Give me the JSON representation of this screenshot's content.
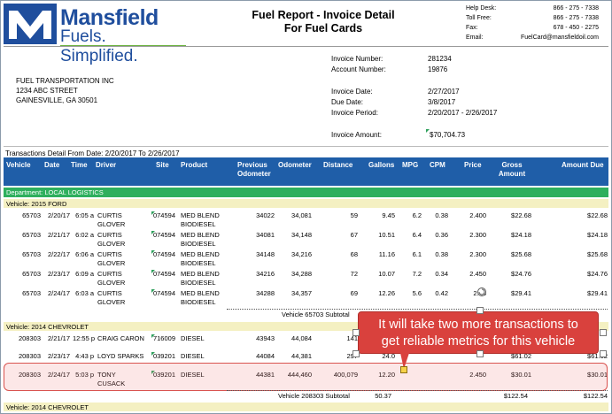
{
  "header": {
    "logo_name": "Mansfield",
    "logo_tagline": "Fuels. Simplified.",
    "title_line1": "Fuel Report - Invoice Detail",
    "title_line2": "For Fuel Cards"
  },
  "contact": {
    "help_label": "Help Desk:",
    "help_value": "866 - 275 - 7338",
    "tollfree_label": "Toll Free:",
    "tollfree_value": "866 - 275 - 7338",
    "fax_label": "Fax:",
    "fax_value": "678 - 450 - 2275",
    "email_label": "Email:",
    "email_value": "FuelCard@mansfieldoil.com"
  },
  "customer": {
    "name": "FUEL TRANSPORTATION INC",
    "street": "1234 ABC STREET",
    "city": "GAINESVILLE, GA 30501"
  },
  "invoice": {
    "number_label": "Invoice Number:",
    "number": "281234",
    "account_label": "Account Number:",
    "account": "19876",
    "date_label": "Invoice Date:",
    "date": "2/27/2017",
    "due_label": "Due Date:",
    "due": "3/8/2017",
    "period_label": "Invoice Period:",
    "period": "2/20/2017 - 2/26/2017",
    "amount_label": "Invoice Amount:",
    "amount": "$70,704.73"
  },
  "table": {
    "caption": "Transactions Detail From Date: 2/20/2017 To 2/26/2017",
    "headers": {
      "vehicle": "Vehicle",
      "date": "Date",
      "time": "Time",
      "driver": "Driver",
      "site": "Site",
      "product": "Product",
      "prev_odo_1": "Previous",
      "prev_odo_2": "Odometer",
      "odometer": "Odometer",
      "distance": "Distance",
      "gallons": "Gallons",
      "mpg": "MPG",
      "cpm": "CPM",
      "price": "Price",
      "gross_1": "Gross",
      "gross_2": "Amount",
      "amount_due": "Amount Due"
    },
    "department": "Department: LOCAL LOGISTICS",
    "group1": {
      "label": "Vehicle:  2015 FORD",
      "rows": [
        {
          "vehicle": "65703",
          "date": "2/20/17",
          "time": "6:05 a",
          "driver1": "CURTIS",
          "driver2": "GLOVER",
          "site": "074594",
          "product1": "MED BLEND",
          "product2": "BIODIESEL",
          "prev": "34022",
          "odo": "34,081",
          "dist": "59",
          "gal": "9.45",
          "mpg": "6.2",
          "cpm": "0.38",
          "price": "2.400",
          "gross": "$22.68",
          "due": "$22.68"
        },
        {
          "vehicle": "65703",
          "date": "2/21/17",
          "time": "6:02 a",
          "driver1": "CURTIS",
          "driver2": "GLOVER",
          "site": "074594",
          "product1": "MED BLEND",
          "product2": "BIODIESEL",
          "prev": "34081",
          "odo": "34,148",
          "dist": "67",
          "gal": "10.51",
          "mpg": "6.4",
          "cpm": "0.36",
          "price": "2.300",
          "gross": "$24.18",
          "due": "$24.18"
        },
        {
          "vehicle": "65703",
          "date": "2/22/17",
          "time": "6:06 a",
          "driver1": "CURTIS",
          "driver2": "GLOVER",
          "site": "074594",
          "product1": "MED BLEND",
          "product2": "BIODIESEL",
          "prev": "34148",
          "odo": "34,216",
          "dist": "68",
          "gal": "11.16",
          "mpg": "6.1",
          "cpm": "0.38",
          "price": "2.300",
          "gross": "$25.68",
          "due": "$25.68"
        },
        {
          "vehicle": "65703",
          "date": "2/23/17",
          "time": "6:09 a",
          "driver1": "CURTIS",
          "driver2": "GLOVER",
          "site": "074594",
          "product1": "MED BLEND",
          "product2": "BIODIESEL",
          "prev": "34216",
          "odo": "34,288",
          "dist": "72",
          "gal": "10.07",
          "mpg": "7.2",
          "cpm": "0.34",
          "price": "2.450",
          "gross": "$24.76",
          "due": "$24.76"
        },
        {
          "vehicle": "65703",
          "date": "2/24/17",
          "time": "6:03 a",
          "driver1": "CURTIS",
          "driver2": "GLOVER",
          "site": "074594",
          "product1": "MED BLEND",
          "product2": "BIODIESEL",
          "prev": "34288",
          "odo": "34,357",
          "dist": "69",
          "gal": "12.26",
          "mpg": "5.6",
          "cpm": "0.42",
          "price": "2.35",
          "gross": "$29.41",
          "due": "$29.41"
        }
      ],
      "subtotal_label": "Vehicle 65703 Subtotal"
    },
    "group2": {
      "label": "Vehicle:  2014 CHEVROLET",
      "rows": [
        {
          "vehicle": "208303",
          "date": "2/21/17",
          "time": "12:55 p",
          "driver1": "CRAIG CARON",
          "driver2": "",
          "site": "716009",
          "product1": "DIESEL",
          "prev": "43943",
          "odo": "44,084",
          "dist": "141"
        },
        {
          "vehicle": "208303",
          "date": "2/23/17",
          "time": "4:43 p",
          "driver1": "LOYD SPARKS",
          "driver2": "",
          "site": "039201",
          "product1": "DIESEL",
          "prev": "44084",
          "odo": "44,381",
          "dist": "297",
          "gal": "24.0",
          "gross": "$61.02",
          "due": "$61.02"
        },
        {
          "vehicle": "208303",
          "date": "2/24/17",
          "time": "5:03 p",
          "driver1": "TONY",
          "driver2": "CUSACK",
          "site": "039201",
          "product1": "DIESEL",
          "prev": "44381",
          "odo": "444,460",
          "dist": "400,079",
          "gal": "12.20",
          "price": "2.450",
          "gross": "$30.01",
          "due": "$30.01"
        }
      ],
      "subtotal_label": "Vehicle 208303 Subtotal",
      "subtotal_gal": "50.37",
      "subtotal_gross": "$122.54",
      "subtotal_due": "$122.54"
    },
    "group3_label": "Vehicle:  2014 CHEVROLET"
  },
  "callout": {
    "line1": "It will take two more transactions to",
    "line2": "get reliable metrics for this vehicle",
    "color": "#d9413d"
  }
}
